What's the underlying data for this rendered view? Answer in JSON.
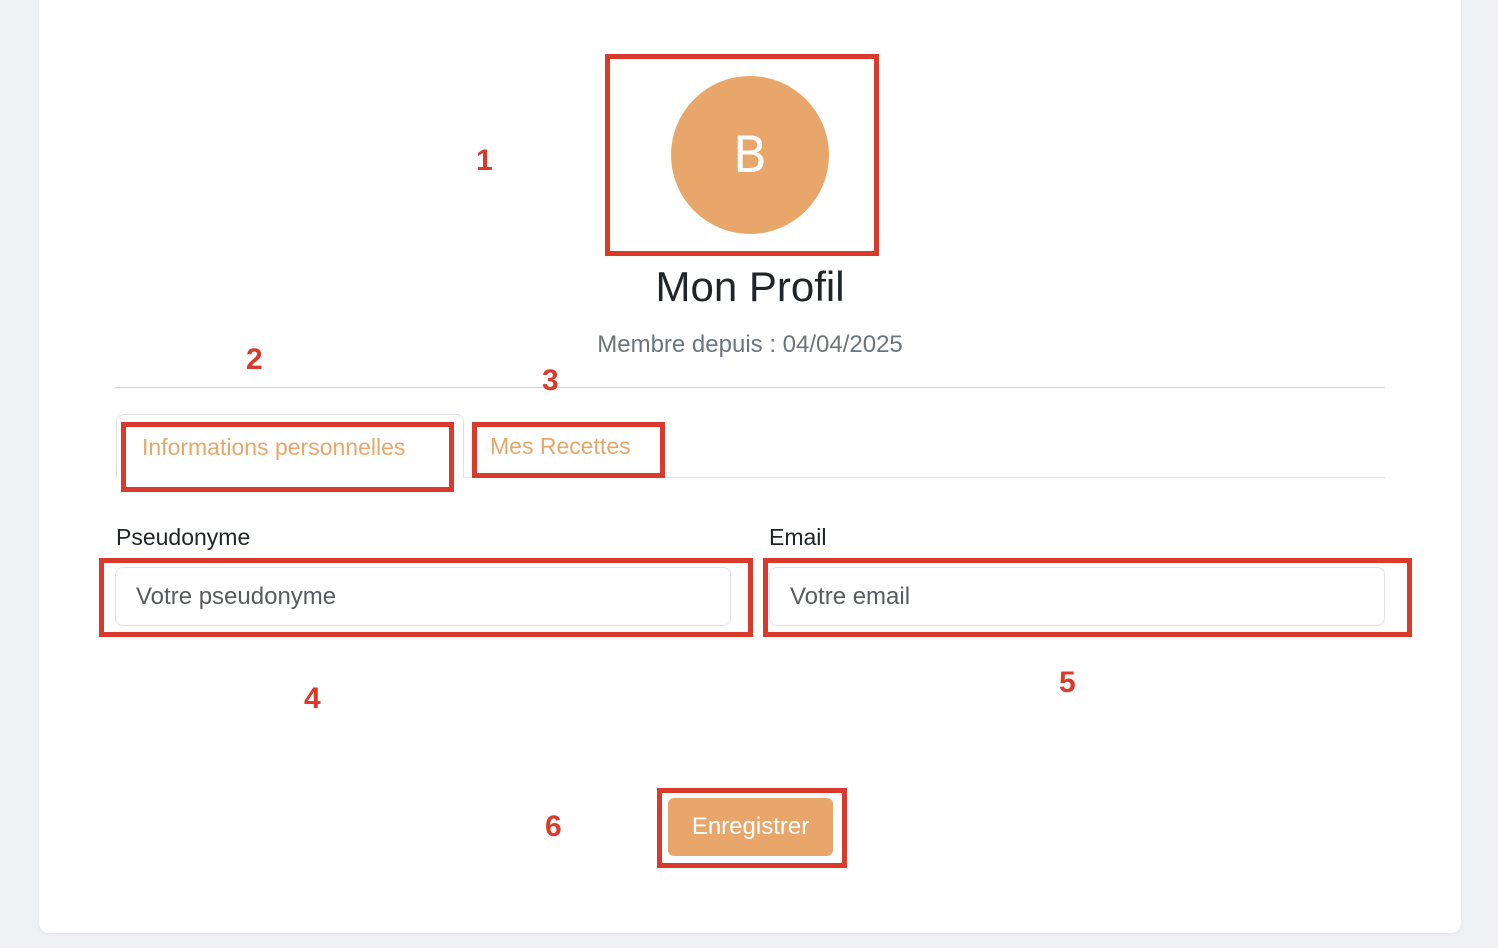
{
  "colors": {
    "accent": "#e8a66a",
    "annotation": "#d93a2b",
    "page_background": "#eff0f4"
  },
  "profile": {
    "avatar_letter": "B",
    "title": "Mon Profil",
    "member_since": "Membre depuis : 04/04/2025"
  },
  "tabs": [
    {
      "label": "Informations personnelles",
      "active": true
    },
    {
      "label": "Mes Recettes",
      "active": false
    }
  ],
  "form": {
    "pseudonyme": {
      "label": "Pseudonyme",
      "placeholder": "Votre pseudonyme",
      "value": ""
    },
    "email": {
      "label": "Email",
      "placeholder": "Votre email",
      "value": ""
    },
    "save_label": "Enregistrer"
  },
  "annotations": [
    "1",
    "2",
    "3",
    "4",
    "5",
    "6"
  ]
}
